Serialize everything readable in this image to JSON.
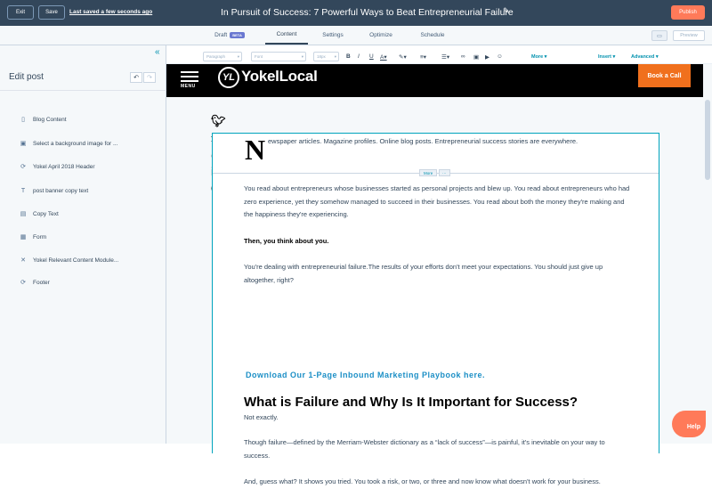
{
  "topbar": {
    "exit_label": "Exit",
    "save_label": "Save",
    "last_saved": "Last saved a few seconds ago",
    "title": "In Pursuit of Success: 7 Powerful Ways to Beat Entrepreneurial Failure",
    "publish_label": "Publish"
  },
  "tabs": [
    {
      "label": "Draft",
      "badge": "BETA"
    },
    {
      "label": "Content"
    },
    {
      "label": "Settings"
    },
    {
      "label": "Optimize"
    },
    {
      "label": "Schedule"
    }
  ],
  "tabbar": {
    "preview_label": "Preview"
  },
  "sidebar": {
    "title": "Edit post",
    "modules": [
      {
        "label": "Blog Content",
        "icon": "document-icon"
      },
      {
        "label": "Select a background image for ...",
        "icon": "image-icon"
      },
      {
        "label": "Yokel April 2018 Header",
        "icon": "global-module-icon"
      },
      {
        "label": "post banner copy text",
        "icon": "text-icon"
      },
      {
        "label": "Copy Text",
        "icon": "rich-text-icon"
      },
      {
        "label": "Form",
        "icon": "form-icon"
      },
      {
        "label": "Yokel Relevant Content Module...",
        "icon": "close-x-icon"
      },
      {
        "label": "Footer",
        "icon": "global-module-icon"
      }
    ]
  },
  "toolbar": {
    "paragraph": "Paragraph",
    "font": "Font",
    "size": "18px",
    "more": "More",
    "insert": "Insert",
    "advanced": "Advanced"
  },
  "site_header": {
    "menu_label": "MENU",
    "logo_text": "YokelLocal",
    "cta_label": "Book a Call"
  },
  "post": {
    "dropcap": "N",
    "intro": "ewspaper articles. Magazine profiles. Online blog posts. Entrepreneurial success stories are everywhere.",
    "more_badge": "More",
    "more_dots": "···",
    "paragraphs": [
      "You read about entrepreneurs whose businesses started as personal projects and blew up. You read about entrepreneurs who had zero experience, yet they somehow managed to succeed in their businesses. You read about both the money they're making and the happiness they're experiencing.",
      "Then, you think about you.",
      "You're dealing with entrepreneurial failure.The results of your efforts don't meet your expectations. You should just give up altogether, right?"
    ],
    "cta_link": "Download Our 1-Page Inbound Marketing Playbook here.",
    "heading": "What is Failure and Why Is It Important for Success?",
    "paragraphs2": [
      "Not exactly.",
      "Though failure—defined by the Merriam-Webster dictionary as a “lack of success”—is painful, it's inevitable on your way to success.",
      "And, guess what? It shows you tried. You took a risk, or two, or three and now know what doesn't work for your business."
    ]
  },
  "help_label": "Help",
  "colors": {
    "topbar": "#33475b",
    "accent": "#ff7a59",
    "link": "#0091ae",
    "cta_orange": "#f0701d"
  }
}
